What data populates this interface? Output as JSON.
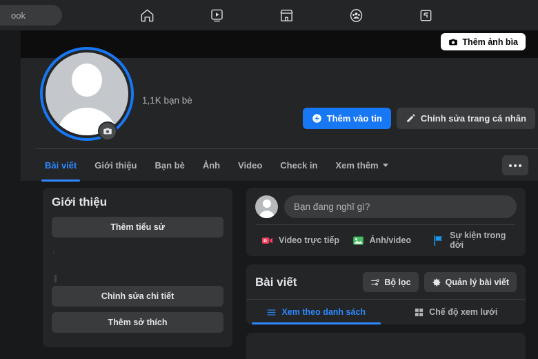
{
  "topbar": {
    "search_text": "ook",
    "nav_icons": [
      {
        "name": "home-icon",
        "label": "Trang chủ"
      },
      {
        "name": "watch-icon",
        "label": "Video"
      },
      {
        "name": "marketplace-icon",
        "label": "Marketplace"
      },
      {
        "name": "groups-icon",
        "label": "Nhóm"
      },
      {
        "name": "gaming-icon",
        "label": "Chơi game"
      }
    ]
  },
  "cover": {
    "add_cover_label": "Thêm ảnh bìa",
    "camera_icon": "camera-icon"
  },
  "profile": {
    "friends_count": "1,1K bạn bè",
    "avatar_camera_icon": "camera-icon",
    "actions": [
      {
        "label": "Thêm vào tin",
        "icon": "plus-circle-icon",
        "style": "primary"
      },
      {
        "label": "Chỉnh sửa trang cá nhân",
        "icon": "pencil-icon",
        "style": "secondary"
      }
    ]
  },
  "tabs": [
    {
      "label": "Bài viết",
      "active": true
    },
    {
      "label": "Giới thiệu",
      "active": false
    },
    {
      "label": "Bạn bè",
      "active": false
    },
    {
      "label": "Ảnh",
      "active": false
    },
    {
      "label": "Video",
      "active": false
    },
    {
      "label": "Check in",
      "active": false
    },
    {
      "label": "Xem thêm",
      "active": false,
      "caret": true
    }
  ],
  "tabs_more_icon": "ellipsis-icon",
  "sidebar": {
    "title": "Giới thiệu",
    "buttons": [
      {
        "label": "Thêm tiểu sử"
      },
      {
        "label": "Chỉnh sửa chi tiết"
      },
      {
        "label": "Thêm sở thích"
      }
    ]
  },
  "composer": {
    "placeholder": "Bạn đang nghĩ gì?",
    "avatar_icon": "avatar-icon",
    "actions": [
      {
        "label": "Video trực tiếp",
        "icon": "live-video-icon",
        "color": "#f3425f"
      },
      {
        "label": "Ảnh/video",
        "icon": "photo-video-icon",
        "color": "#45bd62"
      },
      {
        "label": "Sự kiện trong đời",
        "icon": "life-event-icon",
        "color": "#1b98f0"
      }
    ]
  },
  "posts": {
    "title": "Bài viết",
    "filter_label": "Bộ lọc",
    "filter_icon": "filter-icon",
    "manage_label": "Quản lý bài viết",
    "manage_icon": "gear-icon",
    "view_tabs": [
      {
        "label": "Xem theo danh sách",
        "icon": "list-icon",
        "active": true
      },
      {
        "label": "Chế độ xem lưới",
        "icon": "grid-icon",
        "active": false
      }
    ]
  },
  "colors": {
    "accent": "#1877f2",
    "accent_light": "#2d88ff",
    "card": "#242526",
    "page_bg": "#18191a",
    "control": "#3a3b3c",
    "text_primary": "#e4e6eb",
    "text_secondary": "#b0b3b8",
    "cover_bg": "#0d0d0e"
  }
}
